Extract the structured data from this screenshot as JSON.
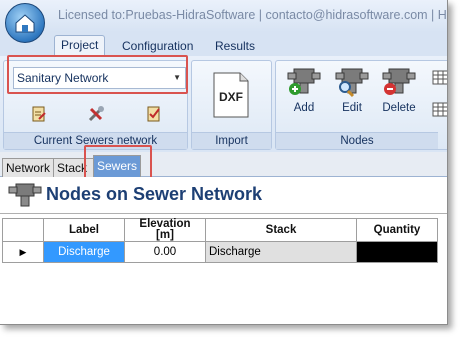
{
  "window": {
    "title": "Licensed to:Pruebas-HidraSoftware  |  contacto@hidrasoftware.com  |  H"
  },
  "ribbon_tabs": [
    "Project",
    "Configuration",
    "Results"
  ],
  "active_ribbon_tab": "Project",
  "ribbon": {
    "network_select": {
      "value": "Sanitary Network"
    },
    "group_sewers_label": "Current Sewers network",
    "group_import_label": "Import",
    "import_button_label": "DXF",
    "group_nodes_label": "Nodes",
    "add_label": "Add",
    "edit_label": "Edit",
    "delete_label": "Delete"
  },
  "doc_tabs": [
    "Network",
    "Stack",
    "Sewers"
  ],
  "active_doc_tab": "Sewers",
  "panel": {
    "title": "Nodes on Sewer Network"
  },
  "table": {
    "columns": [
      "Label",
      "Elevation\n[m]",
      "Stack",
      "Quantity"
    ],
    "rows": [
      {
        "label": "Discharge",
        "elevation": "0.00",
        "stack": "Discharge",
        "quantity": ""
      }
    ]
  },
  "colors": {
    "accent": "#1d3f74",
    "highlight_box": "#d9534f",
    "selected_cell": "#3399ff",
    "active_doc_tab": "#6b9ad6"
  }
}
